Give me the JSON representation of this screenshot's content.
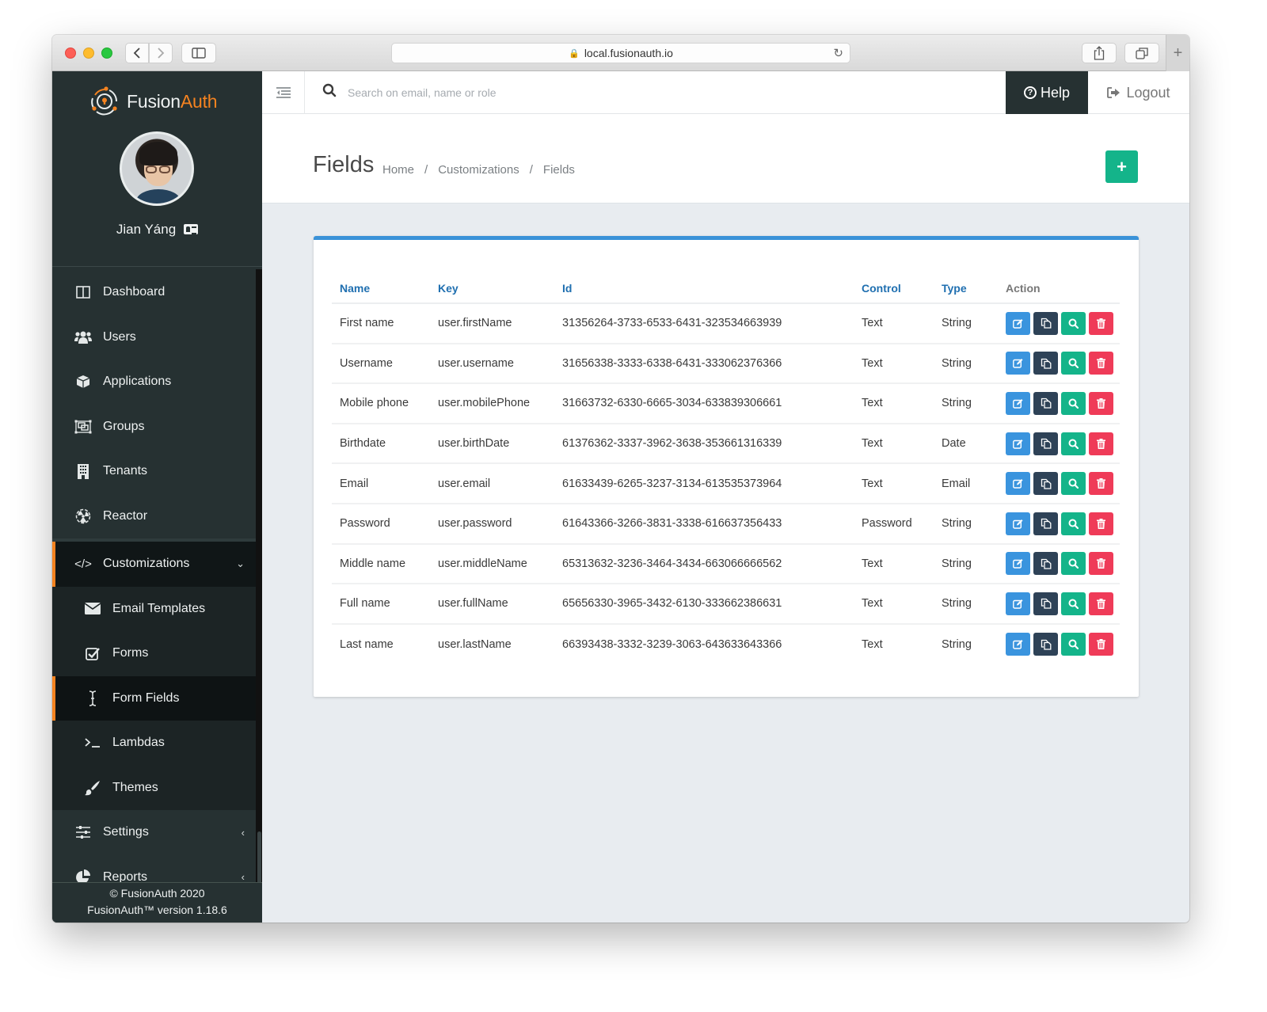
{
  "browser": {
    "url": "local.fusionauth.io",
    "back_icon": "chevron-left-icon",
    "forward_icon": "chevron-right-icon",
    "sidebar_icon": "sidebar-toggle-icon",
    "share_icon": "share-icon",
    "tabs_icon": "tabs-overview-icon",
    "new_tab_label": "+"
  },
  "brand": {
    "name_part1": "Fusion",
    "name_part2": "Auth",
    "accent_color": "#f58320"
  },
  "user": {
    "name": "Jian Yáng",
    "profile_icon": "id-card-icon"
  },
  "sidebar": {
    "items": [
      {
        "label": "Dashboard",
        "icon": "dashboard-icon"
      },
      {
        "label": "Users",
        "icon": "users-icon"
      },
      {
        "label": "Applications",
        "icon": "cube-icon"
      },
      {
        "label": "Groups",
        "icon": "group-objects-icon"
      },
      {
        "label": "Tenants",
        "icon": "building-icon"
      },
      {
        "label": "Reactor",
        "icon": "radiation-icon"
      },
      {
        "label": "Customizations",
        "icon": "code-icon",
        "expanded": true,
        "children": [
          {
            "label": "Email Templates",
            "icon": "envelope-icon"
          },
          {
            "label": "Forms",
            "icon": "checkbox-icon"
          },
          {
            "label": "Form Fields",
            "icon": "text-cursor-icon",
            "active": true
          },
          {
            "label": "Lambdas",
            "icon": "terminal-icon"
          },
          {
            "label": "Themes",
            "icon": "paintbrush-icon"
          }
        ]
      },
      {
        "label": "Settings",
        "icon": "sliders-icon"
      },
      {
        "label": "Reports",
        "icon": "pie-chart-icon"
      }
    ],
    "footer_line1": "© FusionAuth 2020",
    "footer_line2": "FusionAuth™ version 1.18.6"
  },
  "topbar": {
    "search_placeholder": "Search on email, name or role",
    "search_value": "",
    "help_label": "Help",
    "logout_label": "Logout"
  },
  "page": {
    "title": "Fields",
    "breadcrumb": [
      "Home",
      "Customizations",
      "Fields"
    ],
    "add_button_label": "+",
    "add_button_color": "#14b48a"
  },
  "table": {
    "headers": {
      "name": "Name",
      "key": "Key",
      "id": "Id",
      "control": "Control",
      "type": "Type",
      "action": "Action"
    },
    "rows": [
      {
        "name": "First name",
        "key": "user.firstName",
        "id": "31356264-3733-6533-6431-323534663939",
        "control": "Text",
        "type": "String"
      },
      {
        "name": "Username",
        "key": "user.username",
        "id": "31656338-3333-6338-6431-333062376366",
        "control": "Text",
        "type": "String"
      },
      {
        "name": "Mobile phone",
        "key": "user.mobilePhone",
        "id": "31663732-6330-6665-3034-633839306661",
        "control": "Text",
        "type": "String"
      },
      {
        "name": "Birthdate",
        "key": "user.birthDate",
        "id": "61376362-3337-3962-3638-353661316339",
        "control": "Text",
        "type": "Date"
      },
      {
        "name": "Email",
        "key": "user.email",
        "id": "61633439-6265-3237-3134-613535373964",
        "control": "Text",
        "type": "Email"
      },
      {
        "name": "Password",
        "key": "user.password",
        "id": "61643366-3266-3831-3338-616637356433",
        "control": "Password",
        "type": "String"
      },
      {
        "name": "Middle name",
        "key": "user.middleName",
        "id": "65313632-3236-3464-3434-663066666562",
        "control": "Text",
        "type": "String"
      },
      {
        "name": "Full name",
        "key": "user.fullName",
        "id": "65656330-3965-3432-6130-333662386631",
        "control": "Text",
        "type": "String"
      },
      {
        "name": "Last name",
        "key": "user.lastName",
        "id": "66393438-3332-3239-3063-643633643366",
        "control": "Text",
        "type": "String"
      }
    ],
    "action_colors": {
      "edit": "#3a94de",
      "duplicate": "#2e4257",
      "view": "#14b48a",
      "delete": "#ef3b58"
    }
  }
}
